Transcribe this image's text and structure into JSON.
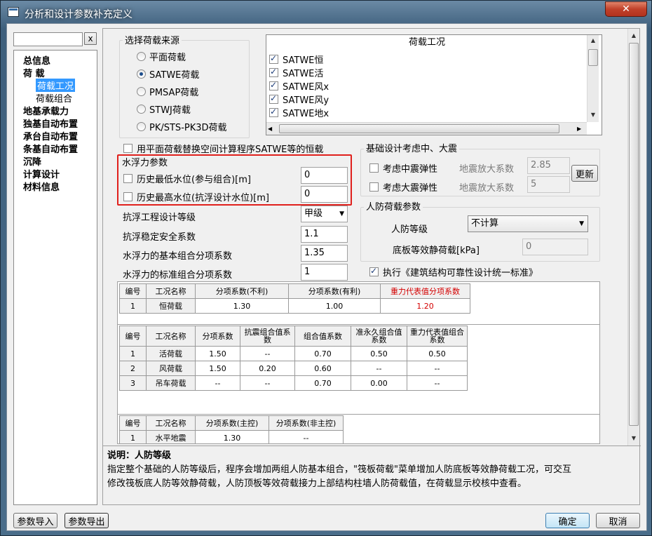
{
  "window": {
    "title": "分析和设计参数补充定义",
    "close_label": "✕"
  },
  "search": {
    "value": "",
    "clear_label": "x"
  },
  "tree": {
    "items": [
      {
        "label": "总信息",
        "level": 0
      },
      {
        "label": "荷  载",
        "level": 0
      },
      {
        "label": "荷载工况",
        "level": 1,
        "selected": true
      },
      {
        "label": "荷载组合",
        "level": 1
      },
      {
        "label": "地基承载力",
        "level": 0
      },
      {
        "label": "独基自动布置",
        "level": 0
      },
      {
        "label": "承台自动布置",
        "level": 0
      },
      {
        "label": "条基自动布置",
        "level": 0
      },
      {
        "label": "沉降",
        "level": 0
      },
      {
        "label": "计算设计",
        "level": 0
      },
      {
        "label": "材料信息",
        "level": 0
      }
    ]
  },
  "load_source": {
    "title": "选择荷载来源",
    "options": [
      "平面荷载",
      "SATWE荷载",
      "PMSAP荷载",
      "STWJ荷载",
      "PK/STS-PK3D荷载"
    ],
    "selected_index": 1
  },
  "load_cases": {
    "header": "荷载工况",
    "items": [
      {
        "label": "SATWE恒",
        "checked": true
      },
      {
        "label": "SATWE活",
        "checked": true
      },
      {
        "label": "SATWE风x",
        "checked": true
      },
      {
        "label": "SATWE风y",
        "checked": true
      },
      {
        "label": "SATWE地x",
        "checked": true
      }
    ]
  },
  "replace_option": {
    "label": "用平面荷载替换空间计算程序SATWE等的恒载",
    "checked": false
  },
  "buoyancy": {
    "title": "水浮力参数",
    "low_label": "历史最低水位(参与组合)[m]",
    "low_checked": false,
    "low_value": "0",
    "high_label": "历史最高水位(抗浮设计水位)[m]",
    "high_checked": false,
    "high_value": "0"
  },
  "anti_float": {
    "grade_label": "抗浮工程设计等级",
    "grade_value": "甲级",
    "safety_label": "抗浮稳定安全系数",
    "safety_value": "1.1",
    "basic_label": "水浮力的基本组合分项系数",
    "basic_value": "1.35",
    "standard_label": "水浮力的标准组合分项系数",
    "standard_value": "1"
  },
  "seismic": {
    "title": "基础设计考虑中、大震",
    "mid_label": "考虑中震弹性",
    "mid_checked": false,
    "big_label": "考虑大震弹性",
    "big_checked": false,
    "factor_label1": "地震放大系数",
    "factor_value1": "2.85",
    "factor_label2": "地震放大系数",
    "factor_value2": "5",
    "refresh_label": "更新"
  },
  "civil_defense": {
    "title": "人防荷载参数",
    "level_label": "人防等级",
    "level_value": "不计算",
    "slab_label": "底板等效静荷载[kPa]",
    "slab_value": "0"
  },
  "standard_check": {
    "label": "执行《建筑结构可靠性设计统一标准》",
    "checked": true
  },
  "table1": {
    "headers": [
      "编号",
      "工况名称",
      "分项系数(不利)",
      "分项系数(有利)",
      "重力代表值分项系数"
    ],
    "rows": [
      [
        "1",
        "恒荷载",
        "1.30",
        "1.00",
        "1.20"
      ]
    ]
  },
  "table2": {
    "headers": [
      "编号",
      "工况名称",
      "分项系数",
      "抗震组合值系数",
      "组合值系数",
      "准永久组合值系数",
      "重力代表值组合系数"
    ],
    "rows": [
      [
        "1",
        "活荷载",
        "1.50",
        "--",
        "0.70",
        "0.50",
        "0.50"
      ],
      [
        "2",
        "风荷载",
        "1.50",
        "0.20",
        "0.60",
        "--",
        "--"
      ],
      [
        "3",
        "吊车荷载",
        "--",
        "--",
        "0.70",
        "0.00",
        "--"
      ]
    ]
  },
  "table3": {
    "headers": [
      "编号",
      "工况名称",
      "分项系数(主控)",
      "分项系数(非主控)"
    ],
    "rows": [
      [
        "1",
        "水平地震",
        "1.30",
        "--"
      ]
    ]
  },
  "description": {
    "title": "说明：人防等级",
    "line1": "指定整个基础的人防等级后，程序会增加两组人防基本组合，\"筏板荷载\"菜单增加人防底板等效静荷载工况，可交互",
    "line2": "修改筏板底人防等效静荷载，人防顶板等效荷载接力上部结构柱墙人防荷载值，在荷载显示校核中查看。"
  },
  "footer": {
    "import_label": "参数导入",
    "export_label": "参数导出",
    "ok_label": "确定",
    "cancel_label": "取消"
  },
  "colors": {
    "highlight_border": "#e0201c",
    "selection": "#3399ff",
    "red_header": "#d40000"
  }
}
